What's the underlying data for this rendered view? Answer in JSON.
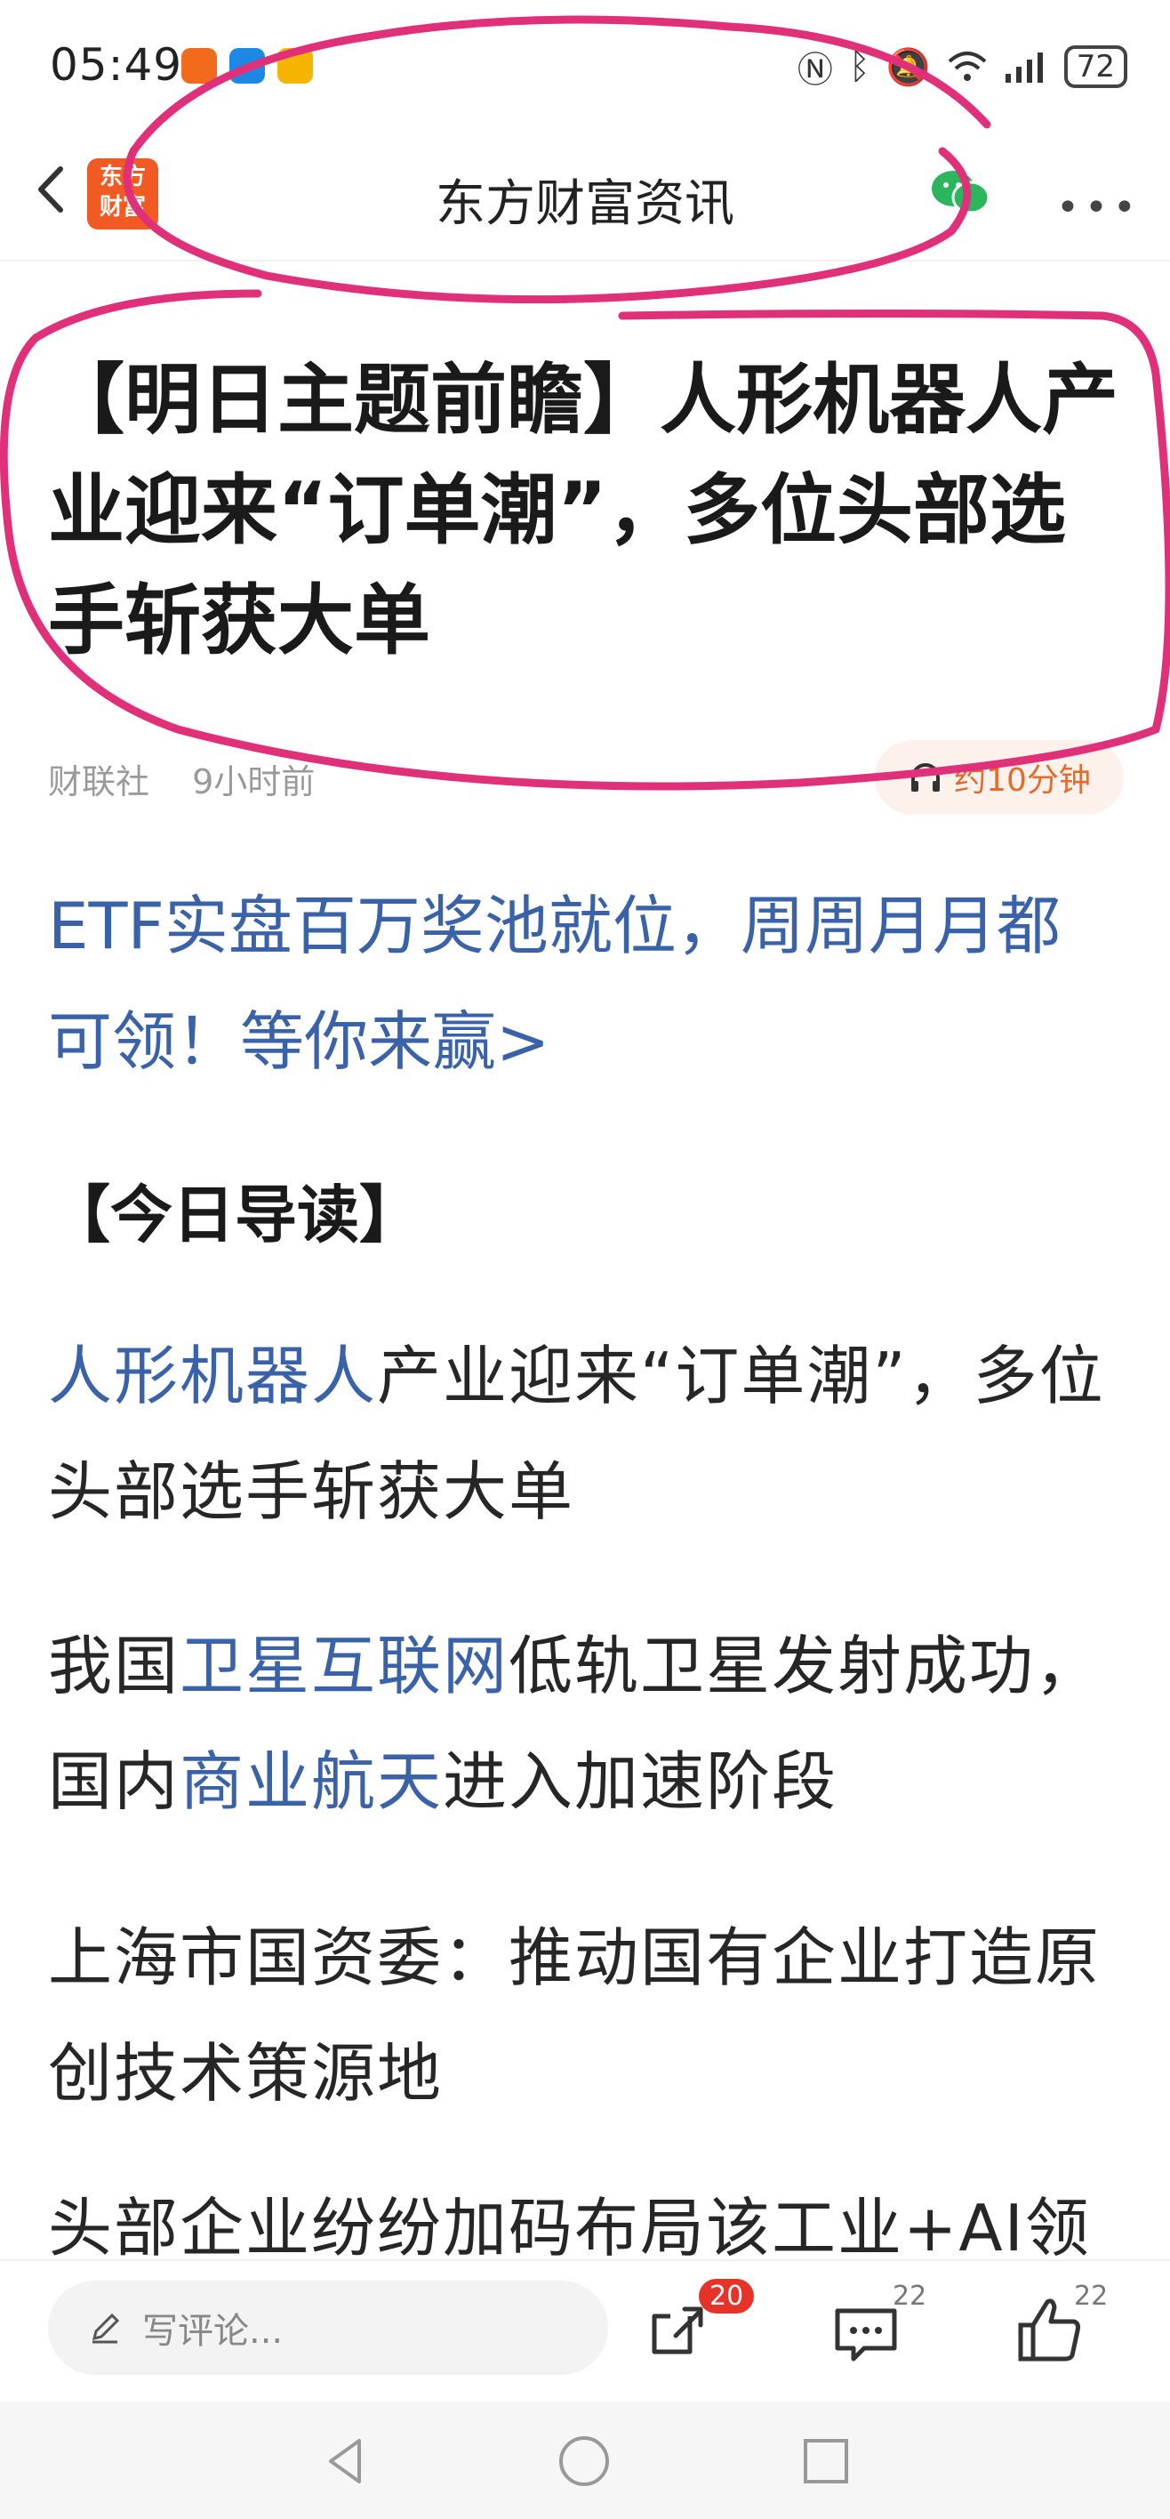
{
  "status_bar": {
    "time": "05:49",
    "battery": "72",
    "icons": [
      "nfc-icon",
      "bluetooth-icon",
      "mute-icon",
      "wifi-icon",
      "signal-icon",
      "battery-icon"
    ]
  },
  "nav": {
    "title": "东方财富资讯",
    "logo_text_line1": "东方",
    "logo_text_line2": "财富"
  },
  "article": {
    "title": "【明日主题前瞻】人形机器人产业迎来“订单潮”，多位头部选手斩获大单",
    "source": "财联社",
    "time": "9小时前",
    "listen_label": "约10分钟",
    "promo": "ETF实盘百万奖池就位，周周月月都可领！等你来赢>",
    "section_heading": "【今日导读】",
    "paragraphs": {
      "p1_link": "人形机器人",
      "p1_text": "产业迎来“订单潮”，多位头部选手斩获大单",
      "p2_a": "我国",
      "p2_link1": "卫星互联网",
      "p2_b": "低轨卫星发射成功，国内",
      "p2_link2": "商业航天",
      "p2_c": "进入加速阶段",
      "p3": "上海市国资委：推动国有企业打造原创技术策源地",
      "p4": "头部企业纷纷加码布局该工业+AI领"
    }
  },
  "bottom_bar": {
    "comment_placeholder": "写评论...",
    "share_badge": "20",
    "comment_count": "22",
    "like_count": "22"
  },
  "colors": {
    "link": "#3a62a8",
    "brand": "#f15a22",
    "annotation": "#e0307a",
    "badge": "#e5332a"
  }
}
